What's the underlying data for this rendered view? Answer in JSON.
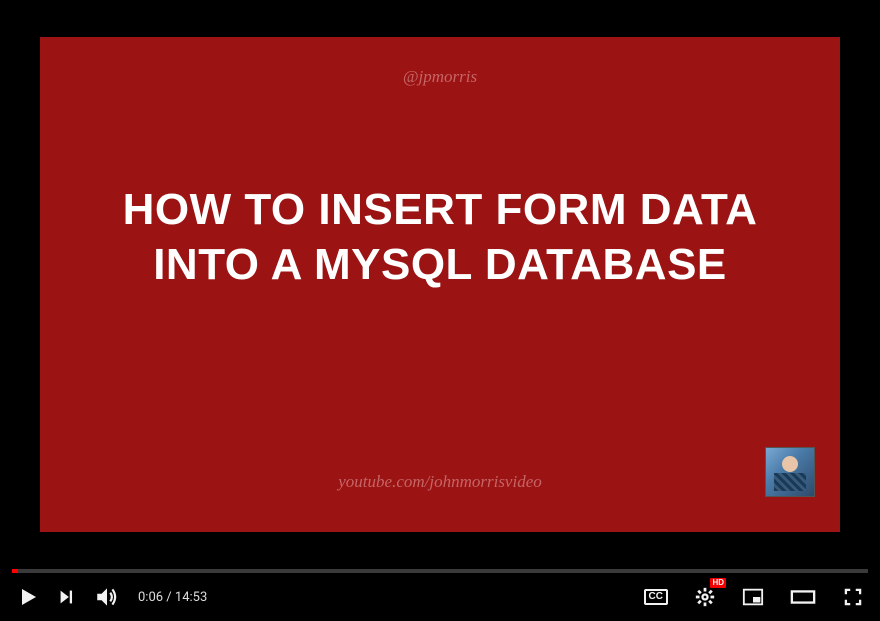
{
  "slide": {
    "handle": "@jpmorris",
    "title_line1": "HOW TO INSERT FORM DATA",
    "title_line2": "INTO A MYSQL DATABASE",
    "url": "youtube.com/johnmorrisvideo"
  },
  "player": {
    "current_time": "0:06",
    "duration": "14:53",
    "separator": " / ",
    "progress_percent": 0.67,
    "cc_label": "CC",
    "hd_label": "HD"
  }
}
